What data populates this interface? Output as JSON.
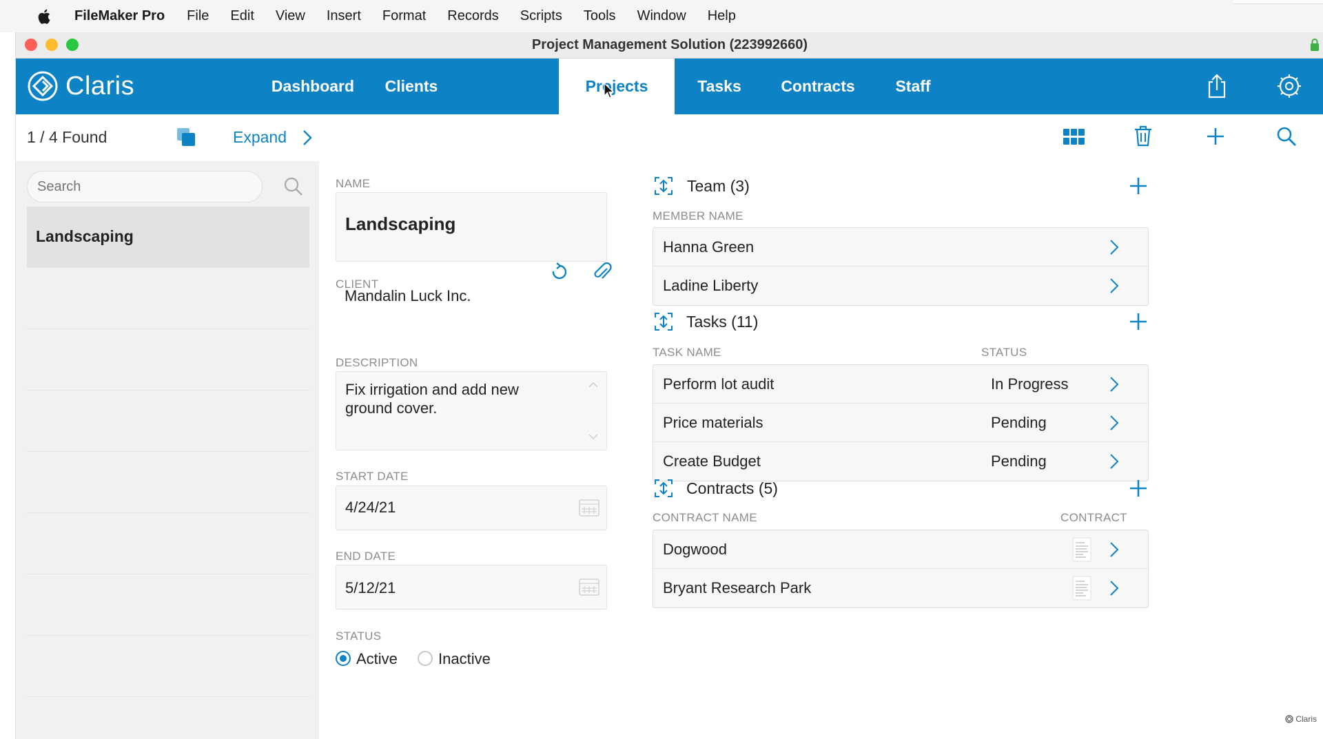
{
  "menubar": {
    "app_name": "FileMaker Pro",
    "items": [
      "File",
      "Edit",
      "View",
      "Insert",
      "Format",
      "Records",
      "Scripts",
      "Tools",
      "Window",
      "Help"
    ]
  },
  "window": {
    "title": "Project Management Solution (223992660)"
  },
  "nav": {
    "brand": "Claris",
    "tabs": [
      {
        "label": "Dashboard",
        "active": false
      },
      {
        "label": "Clients",
        "active": false
      },
      {
        "label": "Projects",
        "active": true
      },
      {
        "label": "Tasks",
        "active": false
      },
      {
        "label": "Contracts",
        "active": false
      },
      {
        "label": "Staff",
        "active": false
      }
    ],
    "icons": [
      "share-icon",
      "gear-icon"
    ]
  },
  "toolbar": {
    "found": "1 / 4 Found",
    "expand_label": "Expand"
  },
  "sidebar": {
    "search_placeholder": "Search",
    "items": [
      {
        "label": "Landscaping",
        "selected": true
      }
    ]
  },
  "form": {
    "name_label": "NAME",
    "name_value": "Landscaping",
    "client_label": "CLIENT",
    "client_value": "Mandalin Luck Inc.",
    "description_label": "DESCRIPTION",
    "description_value": "Fix irrigation and add new ground cover.",
    "start_date_label": "START DATE",
    "start_date_value": "4/24/21",
    "end_date_label": "END DATE",
    "end_date_value": "5/12/21",
    "status_label": "STATUS",
    "status_options": [
      {
        "label": "Active",
        "selected": true
      },
      {
        "label": "Inactive",
        "selected": false
      }
    ]
  },
  "team": {
    "title": "Team (3)",
    "column": "MEMBER NAME",
    "rows": [
      "Hanna Green",
      "Ladine Liberty"
    ]
  },
  "tasks": {
    "title": "Tasks (11)",
    "col_name": "TASK NAME",
    "col_status": "STATUS",
    "rows": [
      {
        "name": "Perform lot audit",
        "status": "In Progress"
      },
      {
        "name": "Price materials",
        "status": "Pending"
      },
      {
        "name": "Create Budget",
        "status": "Pending"
      }
    ]
  },
  "contracts": {
    "title": "Contracts (5)",
    "col_name": "CONTRACT NAME",
    "col_contract": "CONTRACT",
    "rows": [
      "Dogwood",
      "Bryant Research Park"
    ]
  },
  "footer": {
    "mark": "Claris"
  },
  "colors": {
    "accent": "#0d83c6",
    "panel": "#f1f1f1"
  }
}
